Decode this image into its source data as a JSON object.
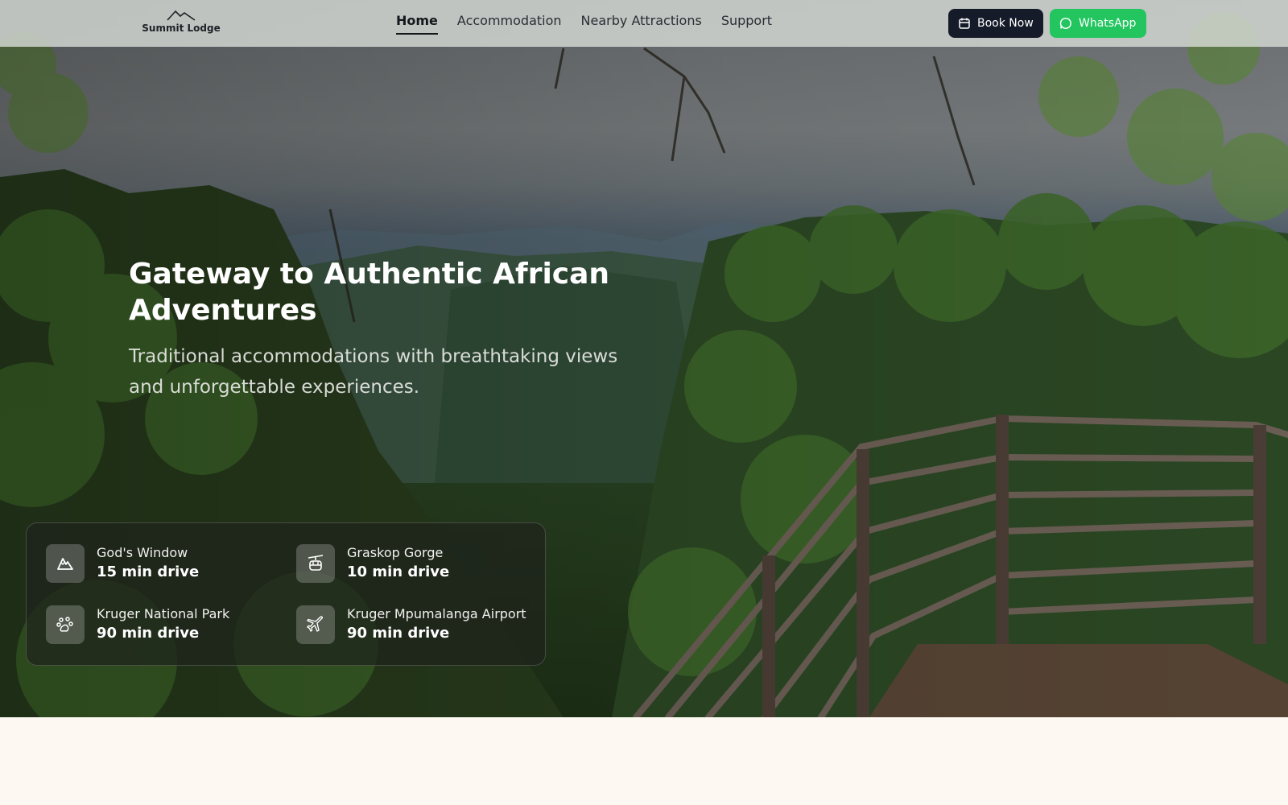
{
  "brand": {
    "name": "Summit Lodge",
    "logo_icon": "mountain-icon"
  },
  "nav": {
    "items": [
      {
        "label": "Home",
        "active": true
      },
      {
        "label": "Accommodation",
        "active": false
      },
      {
        "label": "Nearby Attractions",
        "active": false
      },
      {
        "label": "Support",
        "active": false
      }
    ]
  },
  "actions": {
    "book": {
      "label": "Book Now",
      "icon": "calendar-icon",
      "color": "#151b28"
    },
    "whatsapp": {
      "label": "WhatsApp",
      "icon": "chat-bubble-icon",
      "color": "#22c55e"
    }
  },
  "hero": {
    "title": "Gateway to Authentic African Adventures",
    "subtitle": "Traditional accommodations with breathtaking views and unforgettable experiences."
  },
  "attractions": [
    {
      "name": "God's Window",
      "distance": "15 min drive",
      "icon": "mountain-icon"
    },
    {
      "name": "Graskop Gorge",
      "distance": "10 min drive",
      "icon": "cable-car-icon"
    },
    {
      "name": "Kruger National Park",
      "distance": "90 min drive",
      "icon": "paw-print-icon"
    },
    {
      "name": "Kruger Mpumalanga Airport",
      "distance": "90 min drive",
      "icon": "plane-icon"
    }
  ],
  "theme": {
    "page_background": "#fdf9f2",
    "nav_text": "#2a2d33"
  }
}
